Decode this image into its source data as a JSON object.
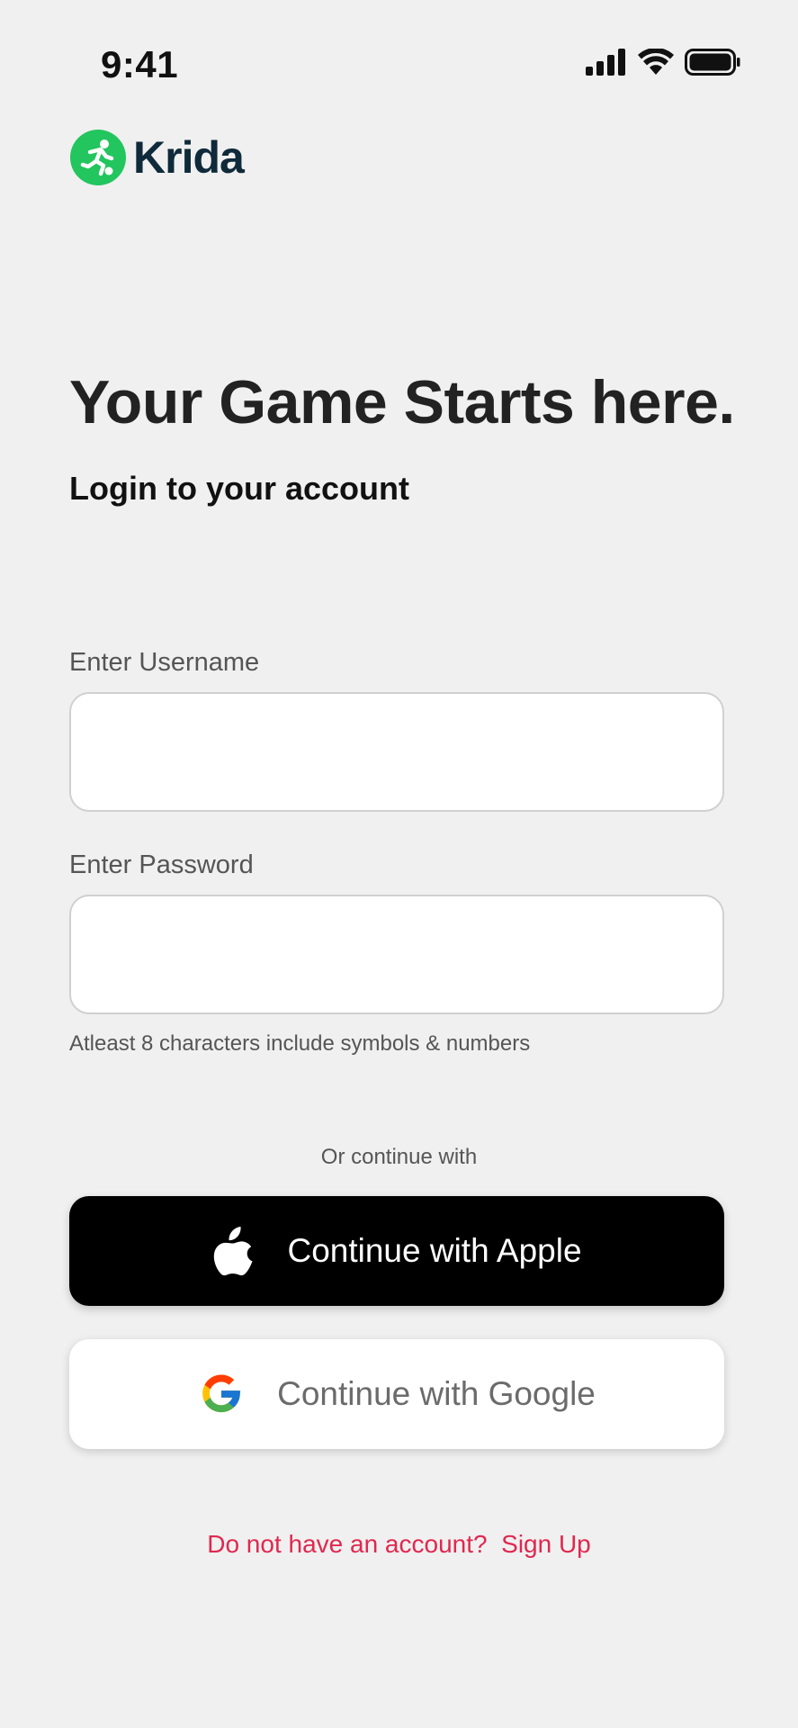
{
  "status_bar": {
    "time": "9:41"
  },
  "brand": {
    "name": "Krida",
    "color": "#22c55e",
    "text_color": "#0f2a3a"
  },
  "headline": "Your Game Starts here.",
  "subhead": "Login to your account",
  "username": {
    "label": "Enter Username",
    "value": "",
    "placeholder": ""
  },
  "password": {
    "label": "Enter Password",
    "value": "",
    "placeholder": "",
    "hint": "Atleast 8 characters include symbols & numbers"
  },
  "alt_login": {
    "or_text": "Or continue with",
    "apple_label": "Continue with Apple",
    "google_label": "Continue with Google"
  },
  "signup": {
    "prompt": "Do not have an account?",
    "link": "Sign Up",
    "color": "#e0284f"
  },
  "icons": {
    "signal": "cellular-signal-icon",
    "wifi": "wifi-icon",
    "battery": "battery-icon",
    "logo": "runner-logo-icon",
    "apple": "apple-icon",
    "google": "google-icon"
  }
}
